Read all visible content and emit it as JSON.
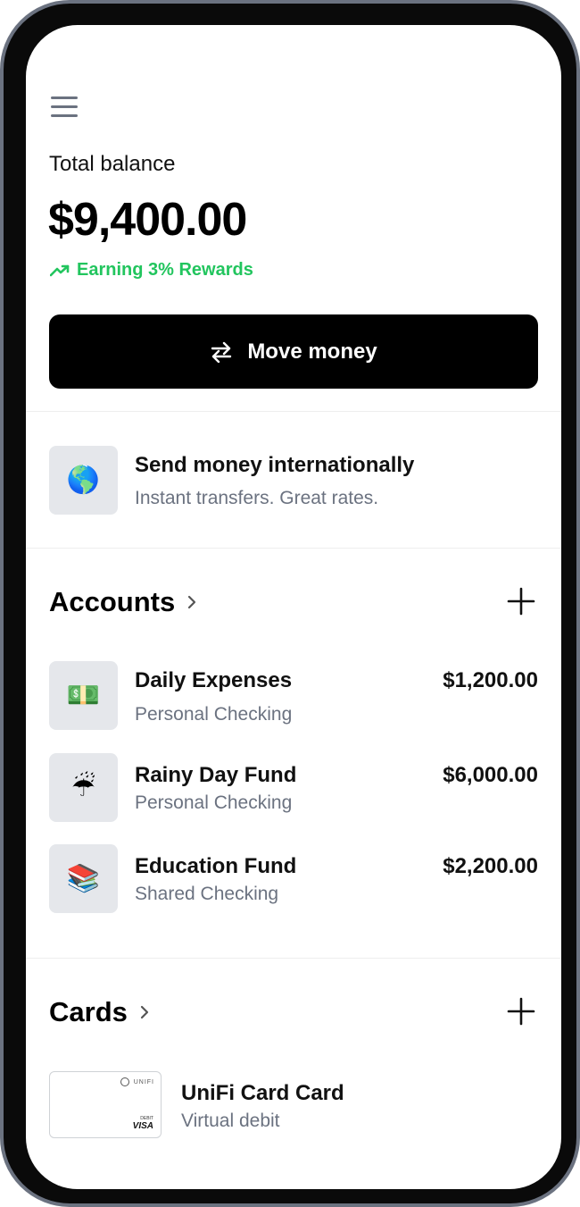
{
  "header": {
    "menu_icon": "hamburger-menu-icon"
  },
  "balance": {
    "label": "Total balance",
    "amount": "$9,400.00",
    "rewards_text": "Earning 3% Rewards",
    "rewards_icon": "trending-up-icon",
    "rewards_color": "#22c55e"
  },
  "move_money": {
    "label": "Move money",
    "icon": "arrows-swap-icon"
  },
  "promo": {
    "emoji": "🌎",
    "title": "Send money internationally",
    "subtitle": "Instant transfers. Great rates."
  },
  "accounts": {
    "title": "Accounts",
    "items": [
      {
        "emoji": "💵",
        "name": "Daily Expenses",
        "type": "Personal Checking",
        "balance": "$1,200.00"
      },
      {
        "emoji": "☔",
        "name": "Rainy Day Fund",
        "type": "Personal Checking",
        "balance": "$6,000.00"
      },
      {
        "emoji": "📚",
        "name": "Education Fund",
        "type": "Shared Checking",
        "balance": "$2,200.00"
      }
    ]
  },
  "cards": {
    "title": "Cards",
    "items": [
      {
        "brand": "UNIFI",
        "debit_label": "DEBIT",
        "network": "VISA",
        "name": "UniFi Card Card",
        "type": "Virtual debit"
      }
    ]
  }
}
